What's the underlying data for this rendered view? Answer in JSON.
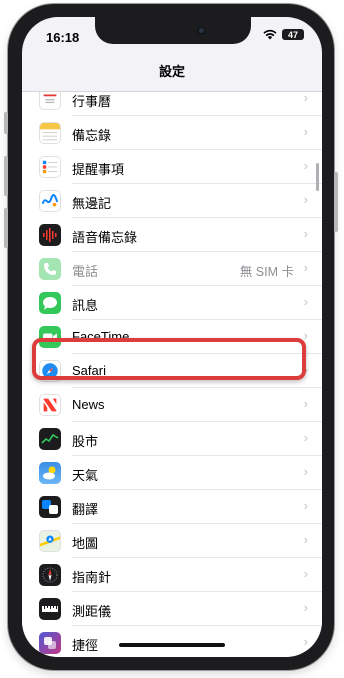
{
  "status_bar": {
    "time": "16:18",
    "battery": "47"
  },
  "nav": {
    "title": "設定"
  },
  "rows": [
    {
      "label": "行事曆",
      "icon": "calendar-icon",
      "value": ""
    },
    {
      "label": "備忘錄",
      "icon": "notes-icon",
      "value": ""
    },
    {
      "label": "提醒事項",
      "icon": "reminders-icon",
      "value": ""
    },
    {
      "label": "無邊記",
      "icon": "freeform-icon",
      "value": ""
    },
    {
      "label": "語音備忘錄",
      "icon": "voice-memos-icon",
      "value": ""
    },
    {
      "label": "電話",
      "icon": "phone-icon",
      "value": "無 SIM 卡"
    },
    {
      "label": "訊息",
      "icon": "messages-icon",
      "value": ""
    },
    {
      "label": "FaceTime",
      "icon": "facetime-icon",
      "value": ""
    },
    {
      "label": "Safari",
      "icon": "safari-icon",
      "value": ""
    },
    {
      "label": "News",
      "icon": "news-icon",
      "value": ""
    },
    {
      "label": "股市",
      "icon": "stocks-icon",
      "value": ""
    },
    {
      "label": "天氣",
      "icon": "weather-icon",
      "value": ""
    },
    {
      "label": "翻譯",
      "icon": "translate-icon",
      "value": ""
    },
    {
      "label": "地圖",
      "icon": "maps-icon",
      "value": ""
    },
    {
      "label": "指南針",
      "icon": "compass-icon",
      "value": ""
    },
    {
      "label": "測距儀",
      "icon": "measure-icon",
      "value": ""
    },
    {
      "label": "捷徑",
      "icon": "shortcuts-icon",
      "value": ""
    }
  ],
  "chevron": "›",
  "highlight_color": "#dc3c3c"
}
